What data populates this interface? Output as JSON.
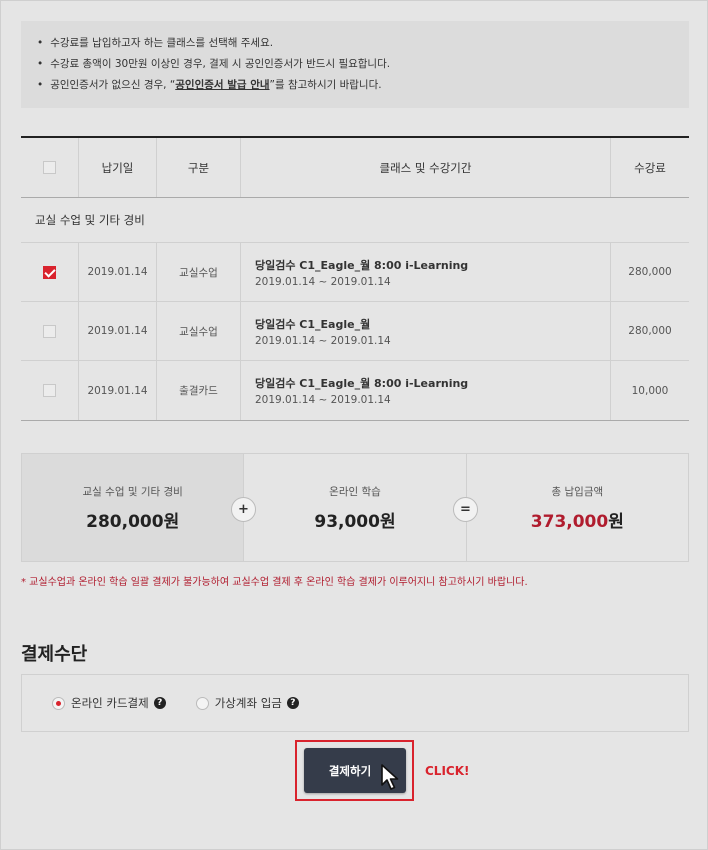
{
  "notice": {
    "line1": "수강료를 납입하고자 하는 클래스를 선택해 주세요.",
    "line2": "수강료 총액이 30만원 이상인 경우, 결제 시 공인인증서가 반드시 필요합니다.",
    "line3_pre": "공인인증서가 없으신 경우, “",
    "line3_link": "공인인증서 발급 안내",
    "line3_post": "”를 참고하시기 바랍니다."
  },
  "table": {
    "headers": [
      "납기일",
      "구분",
      "클래스 및 수강기간",
      "수강료"
    ],
    "group_label": "교실 수업 및 기타 경비",
    "rows": [
      {
        "checked": true,
        "date": "2019.01.14",
        "type": "교실수업",
        "name": "당일검수 C1_Eagle_월 8:00 i-Learning",
        "period": "2019.01.14 ~ 2019.01.14",
        "fee": "280,000"
      },
      {
        "checked": false,
        "date": "2019.01.14",
        "type": "교실수업",
        "name": "당일검수 C1_Eagle_월",
        "period": "2019.01.14 ~ 2019.01.14",
        "fee": "280,000"
      },
      {
        "checked": false,
        "date": "2019.01.14",
        "type": "출결카드",
        "name": "당일검수 C1_Eagle_월 8:00 i-Learning",
        "period": "2019.01.14 ~ 2019.01.14",
        "fee": "10,000"
      }
    ]
  },
  "summary": {
    "classroom_label": "교실 수업 및 기타 경비",
    "classroom_amount": "280,000",
    "online_label": "온라인 학습",
    "online_amount": "93,000",
    "total_label": "총 납입금액",
    "total_amount": "373,000",
    "currency": "원",
    "plus": "+",
    "equals": "="
  },
  "warning": "* 교실수업과 온라인 학습 일괄 결제가 불가능하여 교실수업 결제 후 온라인 학습 결제가 이루어지니 참고하시기 바랍니다.",
  "payment": {
    "title": "결제수단",
    "option_card": "온라인 카드결제",
    "option_account": "가상계좌 입금",
    "selected": "option_card",
    "help_glyph": "?",
    "pay_button": "결제하기",
    "click_label": "CLICK!"
  },
  "colors": {
    "accent": "#d9232d",
    "total": "#b01c2e",
    "button": "#353c4a"
  }
}
